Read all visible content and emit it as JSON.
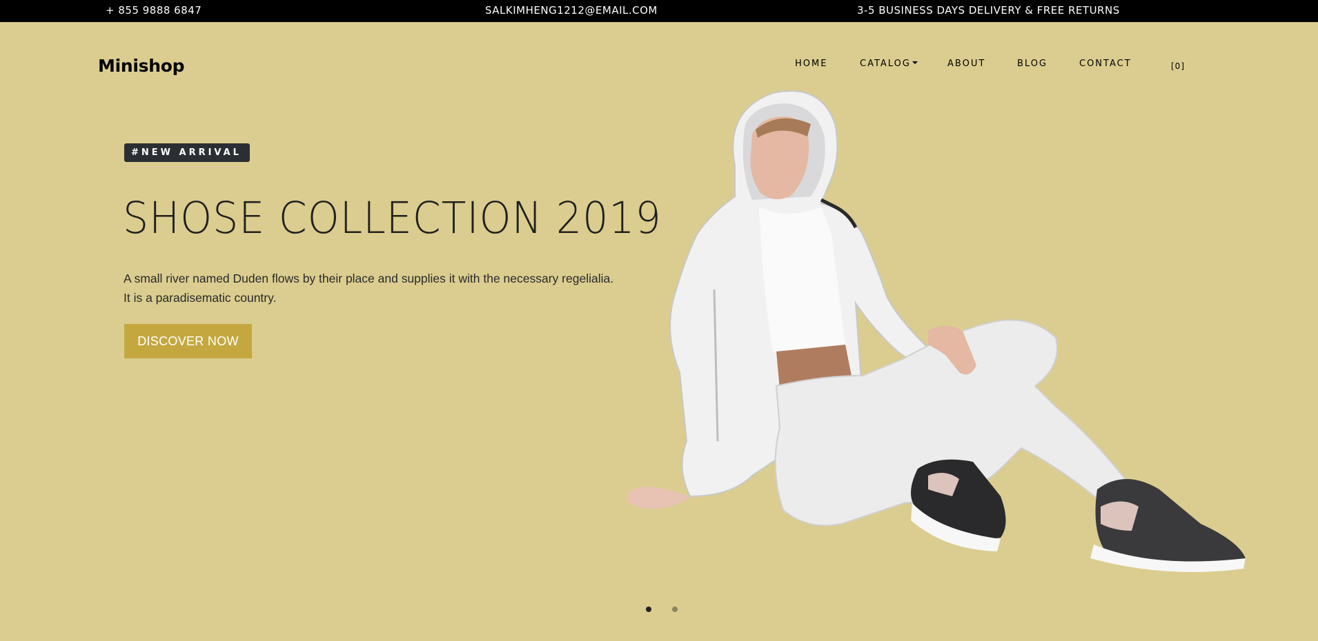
{
  "topbar": {
    "phone": "+ 855 9888 6847",
    "email": "SALKIMHENG1212@EMAIL.COM",
    "delivery": "3-5 BUSINESS DAYS DELIVERY & FREE RETURNS"
  },
  "header": {
    "logo": "Minishop",
    "nav": [
      {
        "label": "HOME"
      },
      {
        "label": "CATALOG",
        "has_dropdown": true
      },
      {
        "label": "ABOUT"
      },
      {
        "label": "BLOG"
      },
      {
        "label": "CONTACT"
      }
    ],
    "cart": "[0]"
  },
  "hero": {
    "badge": "#NEW ARRIVAL",
    "title": "SHOSE COLLECTION 2019",
    "description": "A small river named Duden flows by their place and supplies it with the necessary regelialia. It is a paradisematic country.",
    "cta": "DISCOVER NOW",
    "image": "woman-in-white-tracksuit-and-sneakers"
  },
  "carousel": {
    "slides": 2,
    "active": 1
  },
  "colors": {
    "background": "#dbcd8f",
    "topbar": "#000000",
    "badge": "#2b2e33",
    "accent": "#c4a83f"
  }
}
